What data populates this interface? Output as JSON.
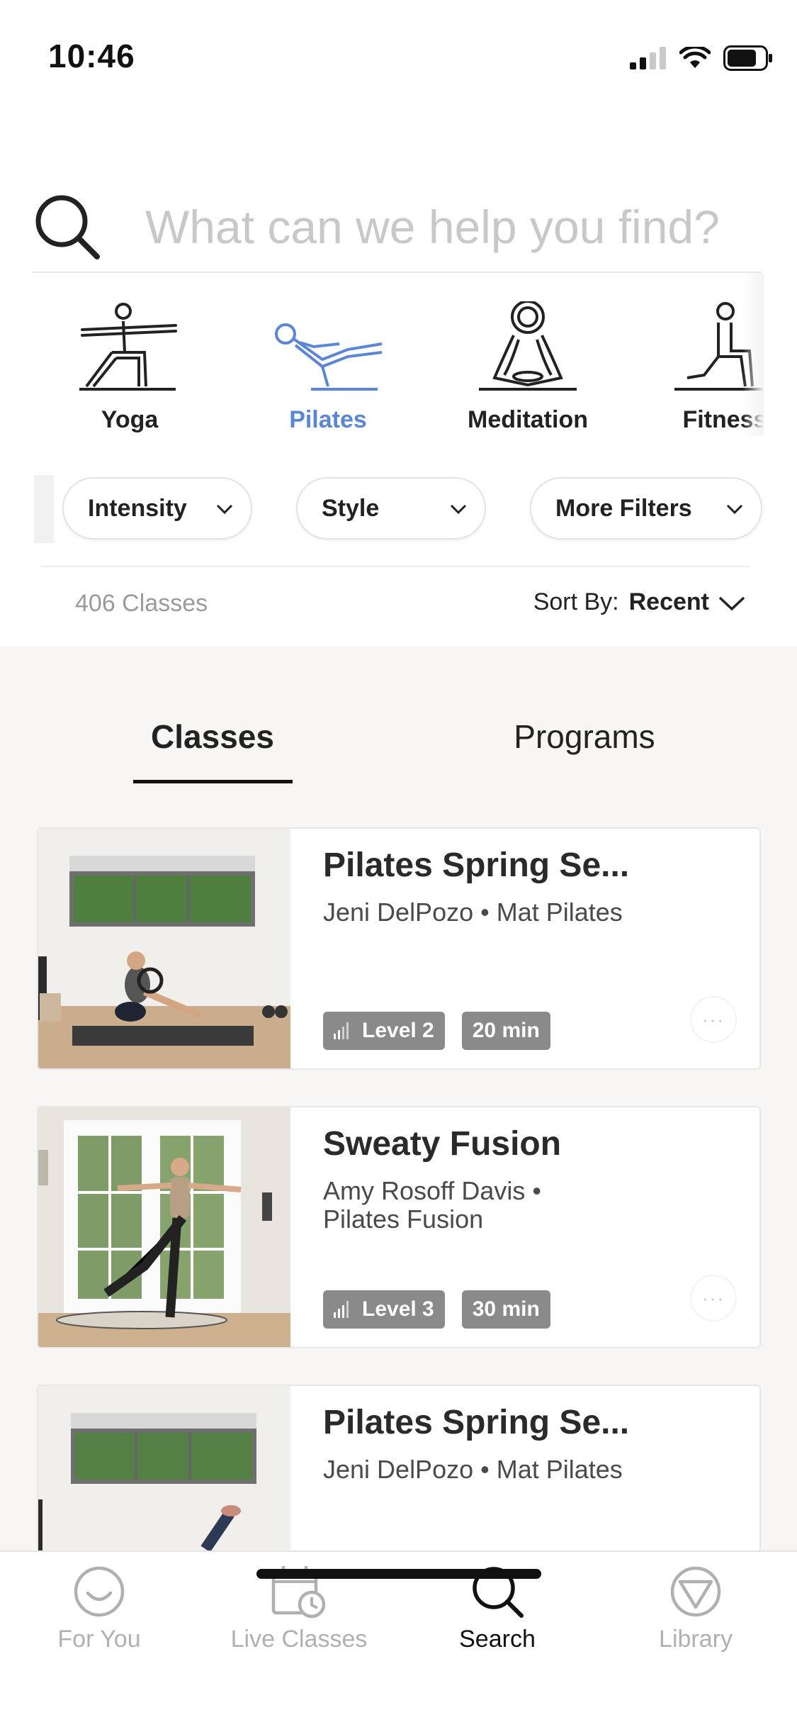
{
  "status_bar": {
    "time": "10:46"
  },
  "search": {
    "placeholder": "What can we help you find?"
  },
  "categories": [
    {
      "label": "Yoga",
      "icon": "yoga-pose-icon",
      "active": false
    },
    {
      "label": "Pilates",
      "icon": "pilates-pose-icon",
      "active": true
    },
    {
      "label": "Meditation",
      "icon": "meditation-pose-icon",
      "active": false
    },
    {
      "label": "Fitness",
      "icon": "fitness-pose-icon",
      "active": false
    }
  ],
  "filters": [
    {
      "label": "Intensity"
    },
    {
      "label": "Style"
    },
    {
      "label": "More Filters"
    }
  ],
  "results": {
    "count_text": "406 Classes",
    "sort_label": "Sort By:",
    "sort_value": "Recent"
  },
  "tabs": [
    {
      "label": "Classes",
      "active": true
    },
    {
      "label": "Programs",
      "active": false
    }
  ],
  "classes": [
    {
      "title": "Pilates Spring Se...",
      "subtitle": "Jeni DelPozo • Mat Pilates",
      "level": "Level 2",
      "duration": "20 min"
    },
    {
      "title": "Sweaty Fusion",
      "subtitle": "Amy Rosoff Davis • Pilates Fusion",
      "level": "Level 3",
      "duration": "30 min"
    },
    {
      "title": "Pilates Spring Se...",
      "subtitle": "Jeni DelPozo • Mat Pilates",
      "level": "",
      "duration": ""
    }
  ],
  "bottom_nav": [
    {
      "label": "For You",
      "icon": "smiley-icon",
      "active": false
    },
    {
      "label": "Live Classes",
      "icon": "calendar-clock-icon",
      "active": false
    },
    {
      "label": "Search",
      "icon": "search-icon",
      "active": true
    },
    {
      "label": "Library",
      "icon": "triangle-circle-icon",
      "active": false
    }
  ],
  "colors": {
    "accent": "#5b86d6",
    "badge": "#8a8a8a",
    "content_bg": "#f7f6f4"
  }
}
